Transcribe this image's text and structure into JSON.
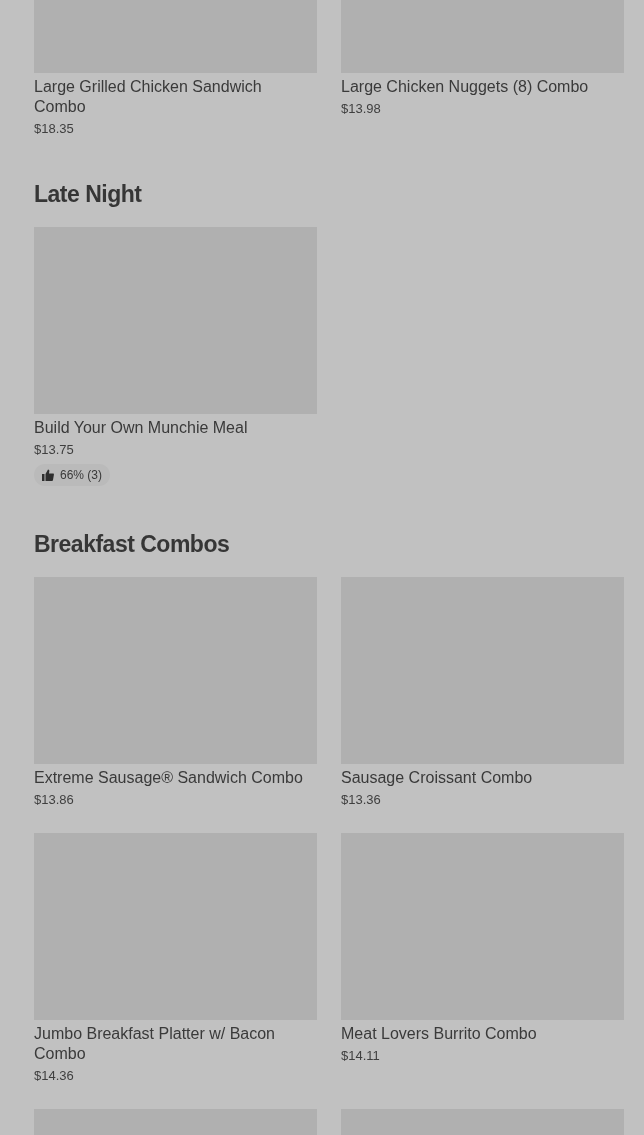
{
  "sections": [
    {
      "items": [
        {
          "name": "Large Grilled Chicken Sandwich Combo",
          "price": "$18.35"
        },
        {
          "name": "Large Chicken Nuggets (8) Combo",
          "price": "$13.98"
        }
      ]
    },
    {
      "title": "Late Night",
      "items": [
        {
          "name": "Build Your Own Munchie Meal",
          "price": "$13.75",
          "rating": "66% (3)"
        }
      ]
    },
    {
      "title": "Breakfast Combos",
      "items": [
        {
          "name": "Extreme Sausage® Sandwich Combo",
          "price": "$13.86"
        },
        {
          "name": "Sausage Croissant Combo",
          "price": "$13.36"
        },
        {
          "name": "Jumbo Breakfast Platter w/ Bacon Combo",
          "price": "$14.36"
        },
        {
          "name": "Meat Lovers Burrito Combo",
          "price": "$14.11"
        },
        {
          "kind": "picture_only"
        },
        {
          "kind": "picture_only"
        }
      ]
    }
  ]
}
